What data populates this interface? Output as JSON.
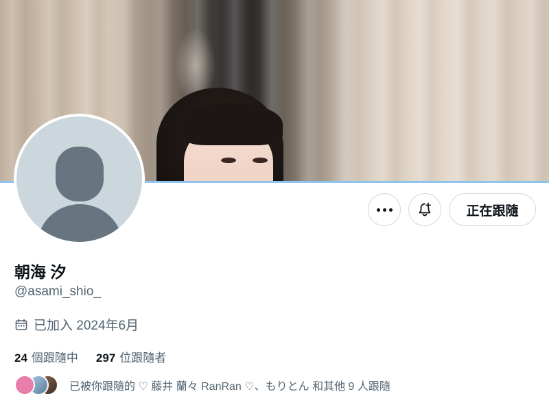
{
  "profile": {
    "display_name": "朝海 汐",
    "handle": "@asami_shio_",
    "joined": "已加入 2024年6月"
  },
  "actions": {
    "more_icon": "more-horizontal-icon",
    "notify_icon": "bell-plus-icon",
    "follow_label": "正在跟隨"
  },
  "stats": {
    "following_count": "24",
    "following_label": "個跟隨中",
    "followers_count": "297",
    "followers_label": "位跟隨者"
  },
  "known_followers": {
    "text": "已被你跟隨的 ♡ 藤井 蘭々 RanRan ♡、もりとん 和其他 9 人跟隨"
  },
  "colors": {
    "accent_edge": "#8ec5f0",
    "secondary_text": "#536471",
    "primary_text": "#0f1419",
    "button_border": "#cfd9de"
  }
}
